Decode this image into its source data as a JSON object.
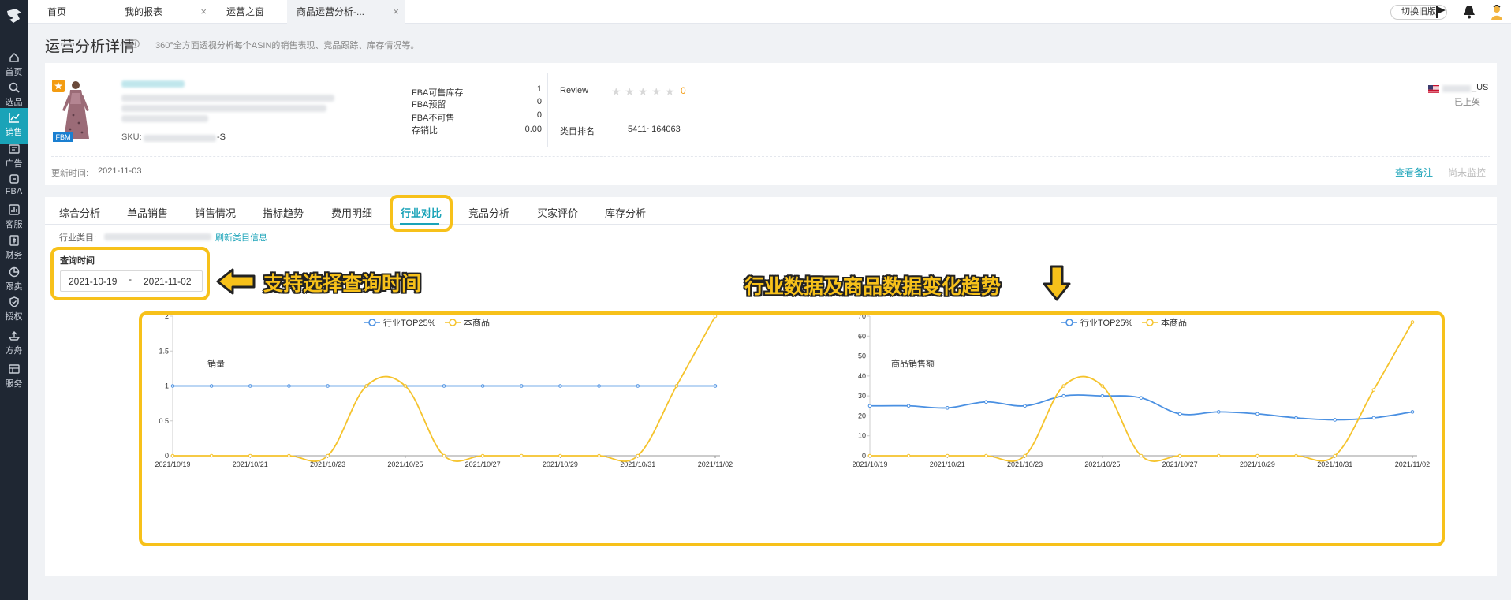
{
  "nav": [
    {
      "label": "首页",
      "icon": "home-icon"
    },
    {
      "label": "选品",
      "icon": "search-icon"
    },
    {
      "label": "销售",
      "icon": "sales-chart-icon"
    },
    {
      "label": "广告",
      "icon": "ad-icon"
    },
    {
      "label": "FBA",
      "icon": "package-icon"
    },
    {
      "label": "客服",
      "icon": "service-icon"
    },
    {
      "label": "财务",
      "icon": "finance-icon"
    },
    {
      "label": "跟卖",
      "icon": "pie-icon"
    },
    {
      "label": "授权",
      "icon": "shield-icon"
    },
    {
      "label": "方舟",
      "icon": "ark-icon"
    },
    {
      "label": "服务",
      "icon": "service-box-icon"
    }
  ],
  "top_tabs": [
    {
      "label": "首页"
    },
    {
      "label": "我的报表"
    },
    {
      "label": "运营之窗"
    },
    {
      "label": "商品运营分析-..."
    }
  ],
  "switch_label": "切换旧版",
  "page": {
    "title": "运营分析详情",
    "desc": "360°全方面透视分析每个ASIN的销售表现、竞品跟踪、库存情况等。"
  },
  "product": {
    "sku_label": "SKU:",
    "sku_suffix": "-S",
    "fbm_badge": "FBM",
    "stats": [
      {
        "label": "FBA可售库存",
        "value": "1"
      },
      {
        "label": "FBA预留",
        "value": "0"
      },
      {
        "label": "FBA不可售",
        "value": "0"
      },
      {
        "label": "存销比",
        "value": "0.00"
      }
    ],
    "review_label": "Review",
    "review_count": "0",
    "rank_label": "类目排名",
    "rank_value": "5411~164063",
    "market": "_US",
    "listed_status": "已上架",
    "update_label": "更新时间:",
    "update_value": "2021-11-03",
    "view_note": "查看备注",
    "not_monitored": "尚未监控"
  },
  "tabs": [
    {
      "label": "综合分析"
    },
    {
      "label": "单品销售"
    },
    {
      "label": "销售情况"
    },
    {
      "label": "指标趋势"
    },
    {
      "label": "费用明细"
    },
    {
      "label": "行业对比"
    },
    {
      "label": "竞品分析"
    },
    {
      "label": "买家评价"
    },
    {
      "label": "库存分析"
    }
  ],
  "category_label": "行业类目:",
  "refresh_label": "刷新类目信息",
  "query": {
    "label": "查询时间",
    "start": "2021-10-19",
    "sep": "-",
    "end": "2021-11-02"
  },
  "annotations": {
    "left": "支持选择查询时间",
    "right": "行业数据及商品数据变化趋势"
  },
  "colors": {
    "accent": "#1aa3b8",
    "highlight": "#f7c11a",
    "series_top25": "#4a90e2",
    "series_product": "#f5c32c"
  },
  "chart_data": [
    {
      "type": "line",
      "ylabel": "销量",
      "x": [
        "2021/10/19",
        "2021/10/20",
        "2021/10/21",
        "2021/10/22",
        "2021/10/23",
        "2021/10/24",
        "2021/10/25",
        "2021/10/26",
        "2021/10/27",
        "2021/10/28",
        "2021/10/29",
        "2021/10/30",
        "2021/10/31",
        "2021/11/01",
        "2021/11/02"
      ],
      "xticks": [
        "2021/10/19",
        "2021/10/21",
        "2021/10/23",
        "2021/10/25",
        "2021/10/27",
        "2021/10/29",
        "2021/10/31",
        "2021/11/02"
      ],
      "ylim": [
        0,
        2
      ],
      "yticks": [
        "0",
        "0.5",
        "1",
        "1.5",
        "2"
      ],
      "yvals": [
        0,
        0.5,
        1,
        1.5,
        2
      ],
      "legend": "top",
      "series": [
        {
          "name": "行业TOP25%",
          "values": [
            1,
            1,
            1,
            1,
            1,
            1,
            1,
            1,
            1,
            1,
            1,
            1,
            1,
            1,
            1
          ]
        },
        {
          "name": "本商品",
          "values": [
            0,
            0,
            0,
            0,
            0,
            1,
            1,
            0,
            0,
            0,
            0,
            0,
            0,
            1,
            2
          ]
        }
      ]
    },
    {
      "type": "line",
      "ylabel": "商品销售额",
      "x": [
        "2021/10/19",
        "2021/10/20",
        "2021/10/21",
        "2021/10/22",
        "2021/10/23",
        "2021/10/24",
        "2021/10/25",
        "2021/10/26",
        "2021/10/27",
        "2021/10/28",
        "2021/10/29",
        "2021/10/30",
        "2021/10/31",
        "2021/11/01",
        "2021/11/02"
      ],
      "xticks": [
        "2021/10/19",
        "2021/10/21",
        "2021/10/23",
        "2021/10/25",
        "2021/10/27",
        "2021/10/29",
        "2021/10/31",
        "2021/11/02"
      ],
      "ylim": [
        0,
        70
      ],
      "yticks": [
        "0",
        "10",
        "20",
        "30",
        "40",
        "50",
        "60",
        "70"
      ],
      "yvals": [
        0,
        10,
        20,
        30,
        40,
        50,
        60,
        70
      ],
      "legend": "top",
      "series": [
        {
          "name": "行业TOP25%",
          "values": [
            25,
            25,
            24,
            27,
            25,
            30,
            30,
            29,
            21,
            22,
            21,
            19,
            18,
            19,
            22
          ]
        },
        {
          "name": "本商品",
          "values": [
            0,
            0,
            0,
            0,
            0,
            35,
            35,
            0,
            0,
            0,
            0,
            0,
            0,
            33,
            67
          ]
        }
      ]
    }
  ]
}
